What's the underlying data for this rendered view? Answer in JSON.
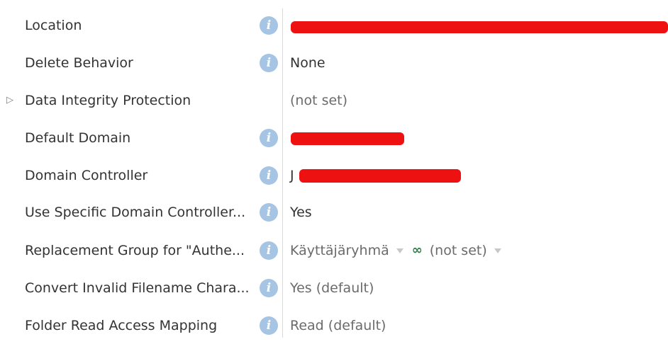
{
  "properties": [
    {
      "label": "Location",
      "value": "",
      "redacted": true,
      "info": true
    },
    {
      "label": "Delete Behavior",
      "value": "None",
      "info": true
    },
    {
      "label": "Data Integrity Protection",
      "value": "(not set)",
      "info": false,
      "expandable": true
    },
    {
      "label": "Default Domain",
      "value": "",
      "redacted": true,
      "info": true
    },
    {
      "label": "Domain Controller",
      "value": "J",
      "redacted": true,
      "info": true
    },
    {
      "label": "Use Specific Domain Controller...",
      "value": "Yes",
      "info": true
    },
    {
      "label": "Replacement Group for \"Authe...",
      "value_primary": "Käyttäjäryhmä",
      "value_secondary": "(not set)",
      "info": true
    },
    {
      "label": "Convert Invalid Filename Chara...",
      "value": "Yes (default)",
      "info": true
    },
    {
      "label": "Folder Read Access Mapping",
      "value": "Read (default)",
      "info": true
    }
  ],
  "icons": {
    "info": "info-icon",
    "expander": "triangle-right-icon",
    "dropdown": "chevron-down-icon",
    "link": "link-icon"
  },
  "colors": {
    "info_icon": "#a6c4e3",
    "redaction": "#ee1111",
    "link": "#2f7d4a"
  }
}
